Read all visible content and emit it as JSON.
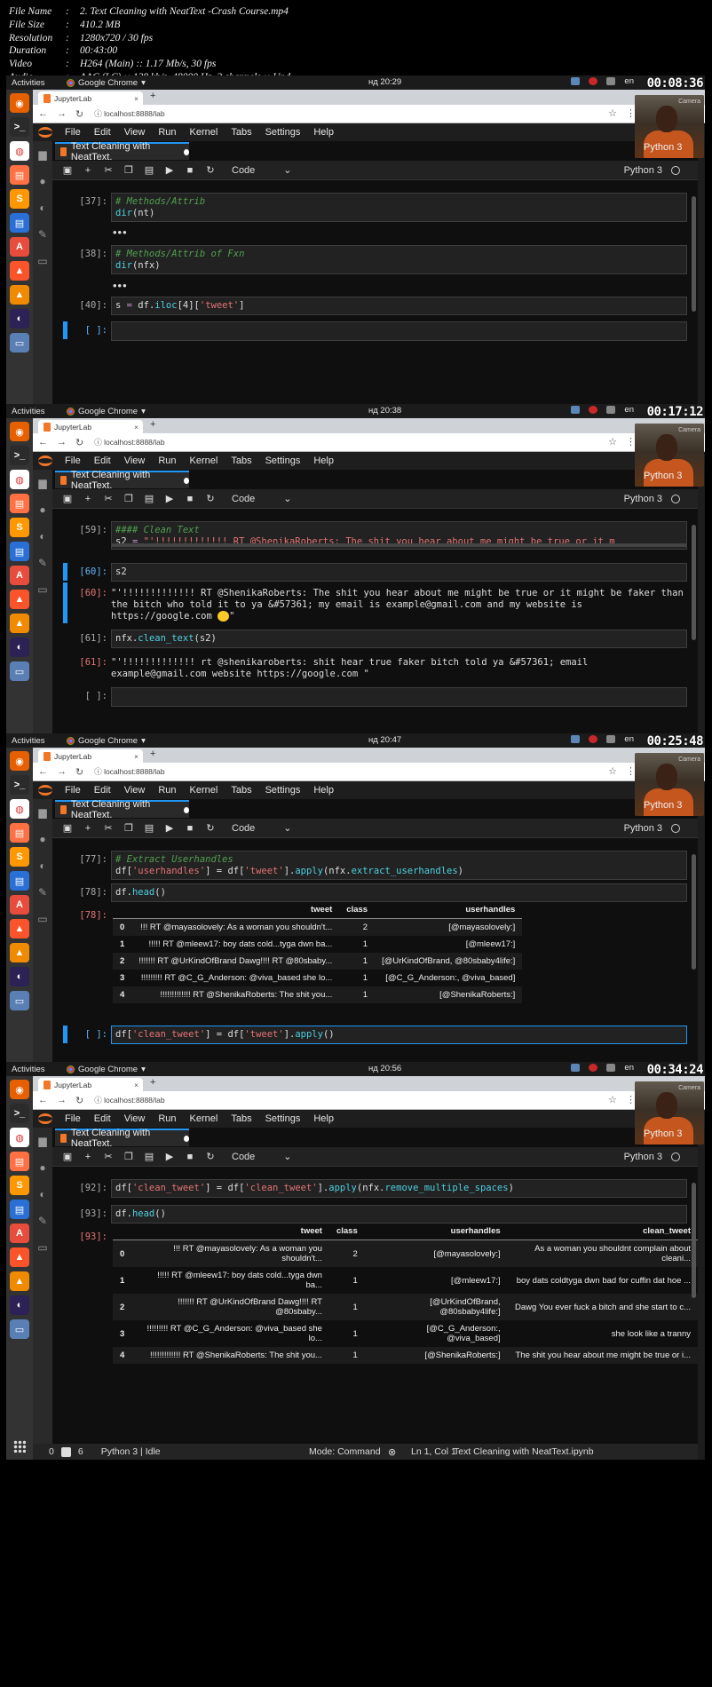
{
  "file_info": [
    {
      "key": "File Name",
      "value": "2. Text Cleaning with NeatText -Crash Course.mp4"
    },
    {
      "key": "File Size",
      "value": "410.2 MB"
    },
    {
      "key": "Resolution",
      "value": "1280x720 / 30 fps"
    },
    {
      "key": "Duration",
      "value": "00:43:00"
    },
    {
      "key": "Video",
      "value": "H264 (Main) :: 1.17 Mb/s, 30 fps"
    },
    {
      "key": "Audio",
      "value": "AAC (LC) :: 128 kb/s, 48000 Hz, 2 channels :: Und"
    }
  ],
  "desktop": {
    "activities": "Activities",
    "app": "Google Chrome",
    "lang": "en",
    "dock_icons": [
      "firefox-icon",
      "terminal-icon",
      "chrome-icon",
      "files-icon",
      "sublime-icon",
      "libreoffice-writer-icon",
      "software-center-icon",
      "brave-icon",
      "vlc-icon",
      "eclipse-icon",
      "desktop-icon"
    ]
  },
  "browser": {
    "tab_title": "JupyterLab",
    "new_tab": "+",
    "url": "localhost:8888/lab"
  },
  "jupyter": {
    "menu": [
      "File",
      "Edit",
      "View",
      "Run",
      "Kernel",
      "Tabs",
      "Settings",
      "Help"
    ],
    "notebook_tab": "Text Cleaning with NeatText.",
    "cell_type": "Code",
    "kernel": "Python 3",
    "cam_label": "Camera",
    "status_zero": "0",
    "status_six": "6",
    "status_kernel": "Python 3 | Idle",
    "notebook_file": "Text Cleaning with NeatText.ipynb"
  },
  "panels": [
    {
      "clock": "нд 20:29",
      "timer": "00:08:36",
      "mode": "Mode: Command",
      "pos": "Ln 1, Col 1",
      "cells": [
        {
          "prompt": "[37]:",
          "lines": [
            [
              [
                "cmt",
                "# Methods/Attrib"
              ]
            ],
            [
              [
                "fn",
                "dir"
              ],
              [
                "",
                "("
              ],
              [
                "",
                "nt"
              ],
              [
                "",
                ")"
              ]
            ]
          ]
        },
        {
          "prompt": "[38]:",
          "lines": [
            [
              [
                "cmt",
                "# Methods/Attrib of Fxn"
              ]
            ],
            [
              [
                "fn",
                "dir"
              ],
              [
                "",
                "("
              ],
              [
                "",
                "nfx"
              ],
              [
                "",
                ")"
              ]
            ]
          ]
        },
        {
          "prompt": "[40]:",
          "lines": [
            [
              [
                "",
                "s "
              ],
              [
                "kw",
                "="
              ],
              [
                "",
                " df."
              ],
              [
                "fn",
                "iloc"
              ],
              [
                "",
                "[4]["
              ],
              [
                "str",
                "'tweet'"
              ],
              [
                "",
                "]"
              ]
            ]
          ]
        },
        {
          "prompt": "[ ]:",
          "lines": [
            [
              [
                "",
                "  "
              ]
            ]
          ]
        }
      ],
      "ellipsis": "•••"
    },
    {
      "clock": "нд 20:38",
      "timer": "00:17:12",
      "mode": "Mode: Command",
      "pos": "Ln 1, Col 3",
      "cells": [
        {
          "prompt": "[59]:",
          "lines": [
            [
              [
                "cmt",
                "#### Clean Text"
              ]
            ],
            [
              [
                "",
                "s2 "
              ],
              [
                "kw",
                "="
              ],
              [
                "str",
                " \"'!!!!!!!!!!!!! RT @ShenikaRoberts: The shit you hear about me might be true or it m"
              ]
            ]
          ]
        },
        {
          "prompt": "[60]:",
          "lines": [
            [
              [
                "",
                "s2"
              ]
            ]
          ]
        },
        {
          "prompt": "[61]:",
          "lines": [
            [
              [
                "",
                "nfx."
              ],
              [
                "fn",
                "clean_text"
              ],
              [
                "",
                "(s2)"
              ]
            ]
          ]
        },
        {
          "prompt": "[ ]:",
          "lines": [
            [
              [
                "",
                ""
              ]
            ]
          ]
        }
      ],
      "out60_prompt": "[60]:",
      "out60": "\"'!!!!!!!!!!!!! RT @ShenikaRoberts: The shit you hear about me might be true or it might be faker than the bitch who told it to ya &#57361; my email is example@gmail.com and my website is https://google.com ",
      "out60_tail": "\"",
      "out61_prompt": "[61]:",
      "out61": "\"'!!!!!!!!!!!!! rt @shenikaroberts: shit hear true faker bitch told ya &#57361; email example@gmail.com website https://google.com \""
    },
    {
      "clock": "нд 20:47",
      "timer": "00:25:48",
      "mode": "Mode: Edit",
      "pos": "Ln 1, Col 39",
      "cells": [
        {
          "prompt": "[77]:",
          "lines": [
            [
              [
                "cmt",
                "# Extract Userhandles"
              ]
            ],
            [
              [
                "",
                "df["
              ],
              [
                "str",
                "'userhandles'"
              ],
              [
                "",
                "] = df["
              ],
              [
                "str",
                "'tweet'"
              ],
              [
                "",
                "]."
              ],
              [
                "fn",
                "apply"
              ],
              [
                "",
                "(nfx."
              ],
              [
                "fn",
                "extract_userhandles"
              ],
              [
                "",
                ")"
              ]
            ]
          ]
        },
        {
          "prompt": "[78]:",
          "lines": [
            [
              [
                "",
                "df."
              ],
              [
                "fn",
                "head"
              ],
              [
                "",
                "()"
              ]
            ]
          ]
        },
        {
          "prompt": "[ ]:",
          "lines": [
            [
              [
                "",
                "df["
              ],
              [
                "str",
                "'clean_tweet'"
              ],
              [
                "",
                "] = df["
              ],
              [
                "str",
                "'tweet'"
              ],
              [
                "",
                "]."
              ],
              [
                "fn",
                "apply"
              ],
              [
                "",
                "()"
              ]
            ]
          ]
        }
      ],
      "out_prompt": "[78]:",
      "table": {
        "columns": [
          "",
          "tweet",
          "class",
          "userhandles"
        ],
        "rows": [
          [
            "0",
            "!!! RT @mayasolovely: As a woman you shouldn't...",
            "2",
            "[@mayasolovely:]"
          ],
          [
            "1",
            "!!!!! RT @mleew17: boy dats cold...tyga dwn ba...",
            "1",
            "[@mleew17:]"
          ],
          [
            "2",
            "!!!!!!! RT @UrKindOfBrand Dawg!!!! RT @80sbaby...",
            "1",
            "[@UrKindOfBrand, @80sbaby4life:]"
          ],
          [
            "3",
            "!!!!!!!!! RT @C_G_Anderson: @viva_based she lo...",
            "1",
            "[@C_G_Anderson:, @viva_based]"
          ],
          [
            "4",
            "!!!!!!!!!!!!! RT @ShenikaRoberts: The shit you...",
            "1",
            "[@ShenikaRoberts:]"
          ]
        ]
      }
    },
    {
      "clock": "нд 20:56",
      "timer": "00:34:24",
      "mode": "Mode: Command",
      "pos": "Ln 1, Col 1",
      "cells": [
        {
          "prompt": "[92]:",
          "lines": [
            [
              [
                "",
                "df["
              ],
              [
                "str",
                "'clean_tweet'"
              ],
              [
                "",
                "] = df["
              ],
              [
                "str",
                "'clean_tweet'"
              ],
              [
                "",
                "]."
              ],
              [
                "fn",
                "apply"
              ],
              [
                "",
                "(nfx."
              ],
              [
                "fn",
                "remove_multiple_spaces"
              ],
              [
                "",
                ")"
              ]
            ]
          ]
        },
        {
          "prompt": "[93]:",
          "lines": [
            [
              [
                "",
                "df."
              ],
              [
                "fn",
                "head"
              ],
              [
                "",
                "()"
              ]
            ]
          ]
        }
      ],
      "out_prompt": "[93]:",
      "table": {
        "columns": [
          "",
          "tweet",
          "class",
          "userhandles",
          "clean_tweet"
        ],
        "rows": [
          [
            "0",
            "!!! RT @mayasolovely: As a woman you shouldn't...",
            "2",
            "[@mayasolovely:]",
            "As a woman you shouldnt complain about cleani..."
          ],
          [
            "1",
            "!!!!! RT @mleew17: boy dats cold...tyga dwn ba...",
            "1",
            "[@mleew17:]",
            "boy dats coldtyga dwn bad for cuffin dat hoe ..."
          ],
          [
            "2",
            "!!!!!!! RT @UrKindOfBrand Dawg!!!! RT @80sbaby...",
            "1",
            "[@UrKindOfBrand, @80sbaby4life:]",
            "Dawg You ever fuck a bitch and she start to c..."
          ],
          [
            "3",
            "!!!!!!!!! RT @C_G_Anderson: @viva_based she lo...",
            "1",
            "[@C_G_Anderson:, @viva_based]",
            "she look like a tranny"
          ],
          [
            "4",
            "!!!!!!!!!!!!! RT @ShenikaRoberts: The shit you...",
            "1",
            "[@ShenikaRoberts:]",
            "The shit you hear about me might be true or i..."
          ]
        ]
      }
    }
  ]
}
